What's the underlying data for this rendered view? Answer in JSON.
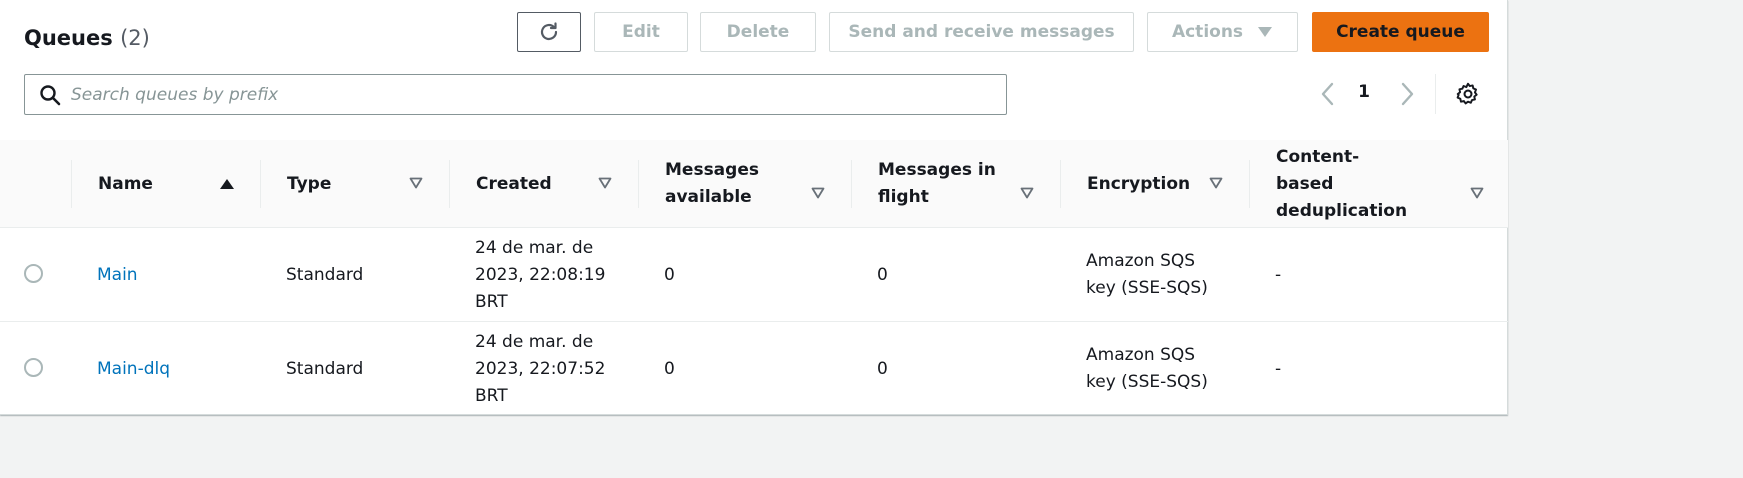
{
  "header": {
    "title": "Queues",
    "count": "(2)"
  },
  "toolbar": {
    "edit_label": "Edit",
    "delete_label": "Delete",
    "send_label": "Send and receive messages",
    "actions_label": "Actions",
    "create_label": "Create queue"
  },
  "search": {
    "placeholder": "Search queues by prefix",
    "value": ""
  },
  "pagination": {
    "current_page": "1"
  },
  "table": {
    "columns": [
      "Name",
      "Type",
      "Created",
      "Messages available",
      "Messages in flight",
      "Encryption",
      "Content-based deduplication"
    ],
    "rows": [
      {
        "name": "Main",
        "type": "Standard",
        "created": "24 de mar. de 2023, 22:08:19 BRT",
        "messages_available": "0",
        "messages_in_flight": "0",
        "encryption": "Amazon SQS key (SSE-SQS)",
        "dedup": "-"
      },
      {
        "name": "Main-dlq",
        "type": "Standard",
        "created": "24 de mar. de 2023, 22:07:52 BRT",
        "messages_available": "0",
        "messages_in_flight": "0",
        "encryption": "Amazon SQS key (SSE-SQS)",
        "dedup": "-"
      }
    ]
  },
  "colors": {
    "primary_button": "#ec7211",
    "link": "#0073bb",
    "disabled_text": "#aab7b8"
  },
  "icons": {
    "refresh": "refresh-icon",
    "search": "search-icon",
    "prev": "chevron-left-icon",
    "next": "chevron-right-icon",
    "settings": "gear-icon",
    "sort_asc": "sort-ascending-icon",
    "sort_unsorted": "sort-unsorted-icon"
  }
}
